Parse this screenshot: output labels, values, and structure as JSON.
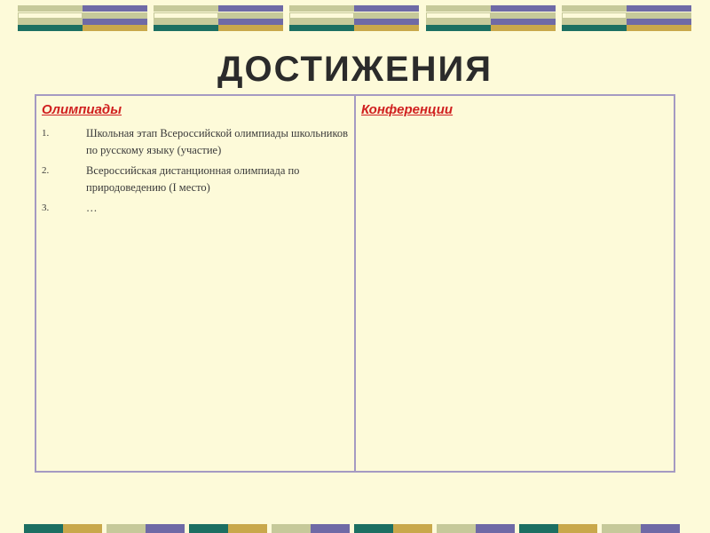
{
  "slide": {
    "title": "ДОСТИЖЕНИЯ"
  },
  "table": {
    "columns": [
      {
        "heading": "Олимпиады",
        "items": [
          {
            "marker": "1.",
            "text": "Школьная этап Всероссийской олимпиады школьников по русскому языку (участие)"
          },
          {
            "marker": "2.",
            "text": "Всероссийская дистанционная олимпиада по природоведению (I место)"
          },
          {
            "marker": "3.",
            "text": "…"
          }
        ]
      },
      {
        "heading": "Конференции",
        "items": []
      }
    ]
  },
  "colors": {
    "background": "#fdfad9",
    "heading": "#d01f1f",
    "border": "#a59ac2",
    "band_teal": "#1c6f62",
    "band_purple": "#6f6aa6",
    "band_gold": "#c9a84b",
    "band_sage": "#c6c99a"
  }
}
